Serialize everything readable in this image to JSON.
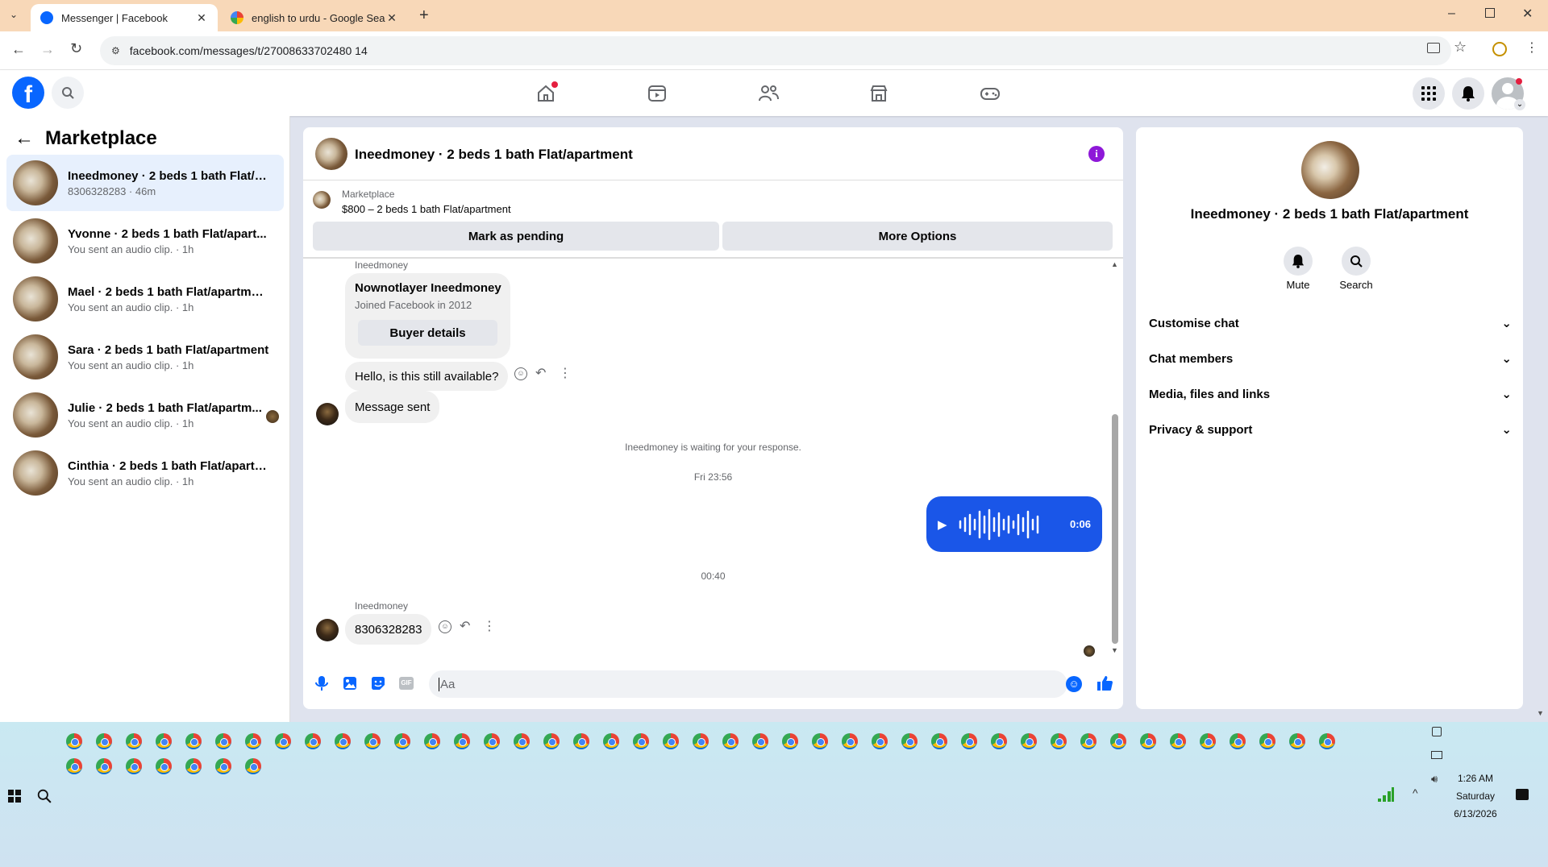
{
  "browser": {
    "tabs": [
      {
        "title": "Messenger | Facebook",
        "active": true
      },
      {
        "title": "english to urdu - Google Search",
        "active": false
      }
    ],
    "url": "facebook.com/messages/t/27008633702480 14"
  },
  "fb": {
    "nav_icons": [
      "home-icon",
      "video-icon",
      "friends-icon",
      "marketplace-icon",
      "gaming-icon"
    ],
    "header_title": "Marketplace"
  },
  "conversations": [
    {
      "name": "Ineedmoney · 2 beds 1 bath Flat/a...",
      "snippet": "8306328283 · 46m",
      "selected": true
    },
    {
      "name": "Yvonne · 2 beds 1 bath Flat/apart...",
      "snippet": "You sent an audio clip. · 1h"
    },
    {
      "name": "Mael · 2 beds 1 bath Flat/apartment",
      "snippet": "You sent an audio clip. · 1h"
    },
    {
      "name": "Sara · 2 beds 1 bath Flat/apartment",
      "snippet": "You sent an audio clip. · 1h"
    },
    {
      "name": "Julie · 2 beds 1 bath Flat/apartm...",
      "snippet": "You sent an audio clip. · 1h"
    },
    {
      "name": "Cinthia · 2 beds 1 bath Flat/apartm...",
      "snippet": "You sent an audio clip. · 1h"
    }
  ],
  "chat": {
    "title": "Ineedmoney · 2 beds 1 bath Flat/apartment",
    "listing_label": "Marketplace",
    "listing_text": "$800 – 2 beds 1 bath Flat/apartment",
    "mark_pending": "Mark as pending",
    "more_options": "More Options",
    "sender_label": "Ineedmoney",
    "card_name": "Nownotlayer Ineedmoney",
    "card_sub": "Joined Facebook in 2012",
    "buyer_details": "Buyer details",
    "msg1": "Hello, is this still available?",
    "msg2": "Message sent",
    "waiting": "Ineedmoney is waiting for your response.",
    "time1": "Fri 23:56",
    "audio_duration": "0:06",
    "time2": "00:40",
    "sender_label2": "Ineedmoney",
    "msg3": "8306328283",
    "composer_placeholder": "Aa"
  },
  "info": {
    "title": "Ineedmoney · 2 beds 1 bath Flat/apartment",
    "mute": "Mute",
    "search": "Search",
    "sections": [
      "Customise chat",
      "Chat members",
      "Media, files and links",
      "Privacy & support"
    ]
  },
  "taskbar": {
    "time": "1:26 AM",
    "day": "Saturday",
    "date": "6/13/2026"
  },
  "colors": {
    "accent": "#0866ff",
    "audio_bubble": "#1a56e8",
    "info_icon": "#8e18d8"
  }
}
